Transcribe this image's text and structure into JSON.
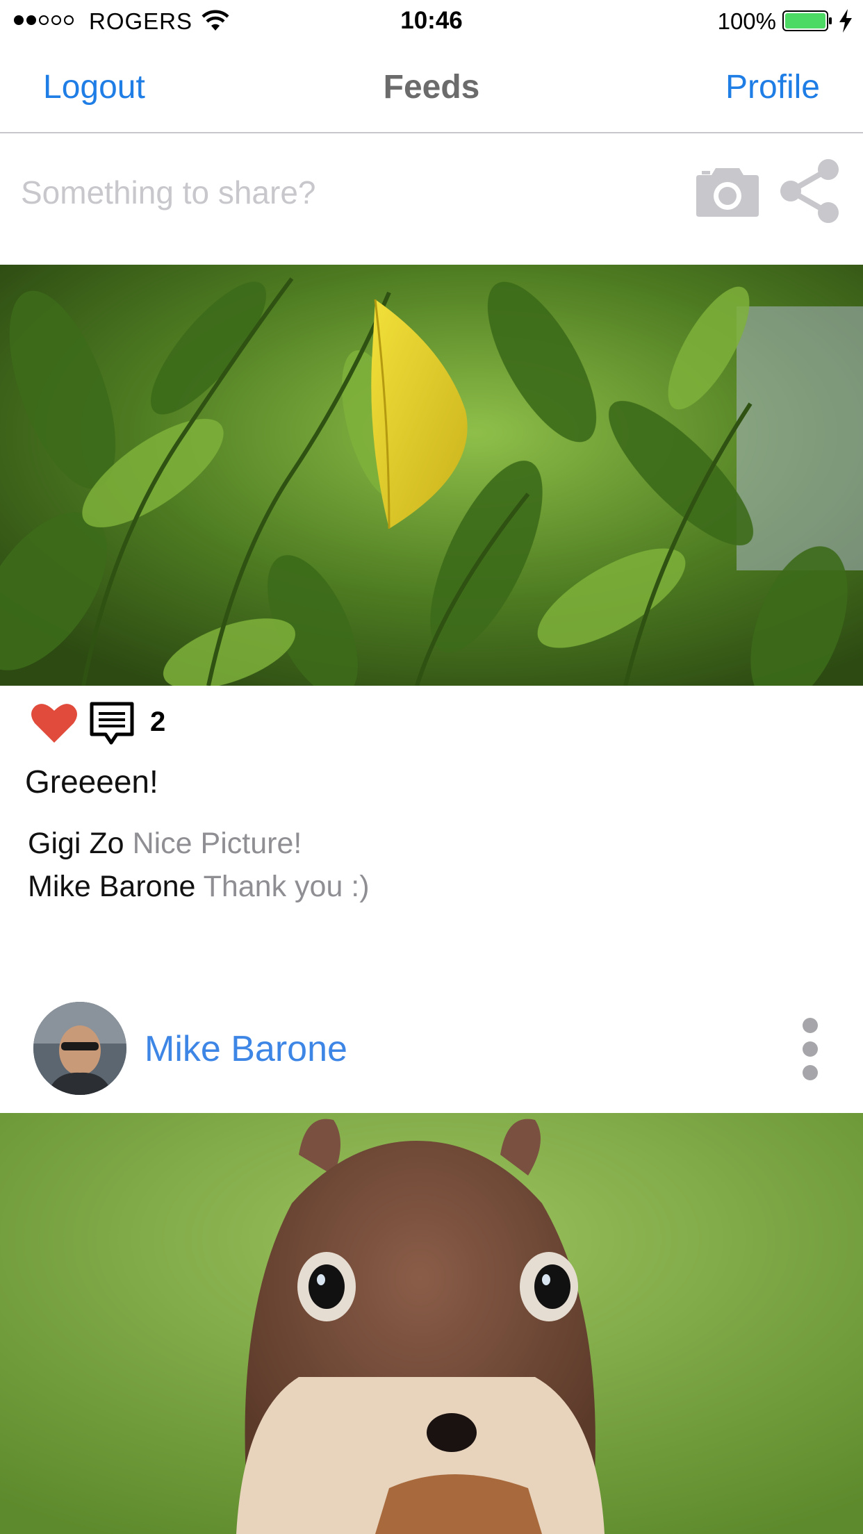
{
  "status_bar": {
    "carrier": "ROGERS",
    "signal_bars_filled": 2,
    "signal_bars_total": 5,
    "time": "10:46",
    "battery_percent": "100%",
    "battery_color": "#4cd964",
    "icons": [
      "wifi-icon",
      "battery-icon",
      "charging-bolt-icon"
    ]
  },
  "nav": {
    "left_label": "Logout",
    "title": "Feeds",
    "right_label": "Profile",
    "accent_color": "#1f7de6"
  },
  "composer": {
    "placeholder": "Something to share?",
    "value": "",
    "icons": [
      "camera-icon",
      "share-icon"
    ]
  },
  "posts": [
    {
      "image_subject": "green leaves with a yellow leaf",
      "liked": true,
      "comment_count": "2",
      "caption": "Greeeen!",
      "comments": [
        {
          "author": "Gigi Zo",
          "text": "Nice Picture!"
        },
        {
          "author": "Mike Barone",
          "text": "Thank you :)"
        }
      ]
    },
    {
      "author": "Mike Barone",
      "image_subject": "chipmunk close-up",
      "icons": [
        "avatar",
        "more-vertical-icon"
      ]
    }
  ]
}
